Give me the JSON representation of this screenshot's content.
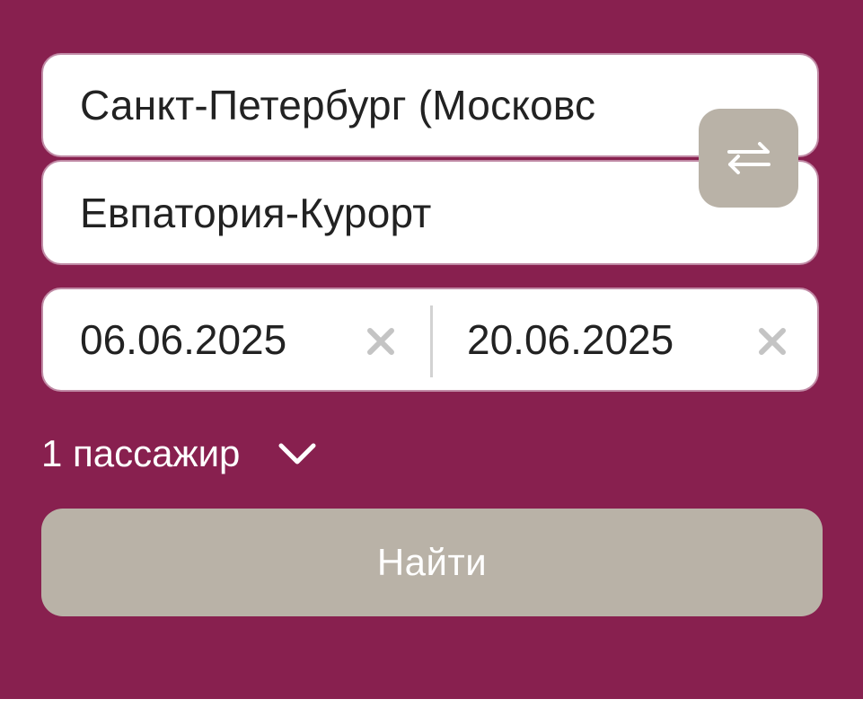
{
  "route": {
    "from_value": "Санкт-Петербург (Московс",
    "to_value": "Евпатория-Курорт",
    "swap_icon": "swap-arrows-icon"
  },
  "dates": {
    "departure": "06.06.2025",
    "return": "20.06.2025",
    "clear_icon": "close-icon"
  },
  "passengers": {
    "label": "1 пассажир",
    "icon": "chevron-down-icon"
  },
  "search": {
    "label": "Найти"
  },
  "colors": {
    "background": "#88204f",
    "field_background": "#ffffff",
    "button_muted": "#b9b2a7",
    "text_dark": "#222222",
    "text_light": "#ffffff",
    "clear_icon": "#c4c4c4"
  }
}
